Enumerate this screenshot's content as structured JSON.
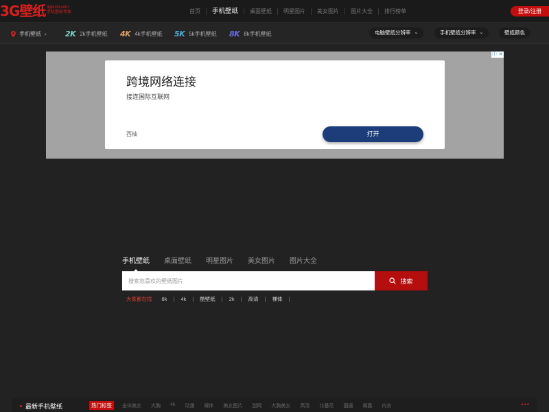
{
  "header": {
    "logo_main": "3G壁纸",
    "logo_domain": "3gbizhi.com",
    "logo_slogan": "手机壁纸专家",
    "nav": [
      "首页",
      "手机壁纸",
      "桌面壁纸",
      "明星图片",
      "美女图片",
      "图片大全",
      "排行榜单"
    ],
    "active_nav": "手机壁纸",
    "login": "登录/注册"
  },
  "subnav": {
    "location": "手机壁纸",
    "resolutions": [
      {
        "badge": "2K",
        "label": "2k手机壁纸",
        "color": "#7fd1c4"
      },
      {
        "badge": "4K",
        "label": "4k手机壁纸",
        "color": "#e0a060"
      },
      {
        "badge": "5K",
        "label": "5k手机壁纸",
        "color": "#4ab0d8"
      },
      {
        "badge": "8K",
        "label": "8k手机壁纸",
        "color": "#6a6ce0"
      }
    ],
    "dropdowns": [
      "电脑壁纸分辨率",
      "手机壁纸分辨率",
      "壁纸颜色"
    ]
  },
  "ad": {
    "title": "跨境网络连接",
    "subtitle": "接连国际互联网",
    "brand": "西柚",
    "open": "打开"
  },
  "search": {
    "tabs": [
      "手机壁纸",
      "桌面壁纸",
      "明星图片",
      "美女图片",
      "图片大全"
    ],
    "active_tab": "手机壁纸",
    "placeholder": "搜索您喜欢的壁纸图片",
    "button": "搜索",
    "hot_label": "大家都在找",
    "hot": [
      "8k",
      "4k",
      "酷壁纸",
      "2k",
      "高清",
      "裸体"
    ]
  },
  "bottom": {
    "title": "最新手机壁纸",
    "hot_tag": "热门标签",
    "tags": [
      "全体美女",
      "大胸",
      "4k",
      "动漫",
      "裸体",
      "美女图片",
      "甜网",
      "大胸美女",
      "高清",
      "比基尼",
      "国摄",
      "裸露",
      "内衣"
    ],
    "more": "•••"
  },
  "colors": {
    "accent": "#c40e0e",
    "bg": "#222223"
  }
}
